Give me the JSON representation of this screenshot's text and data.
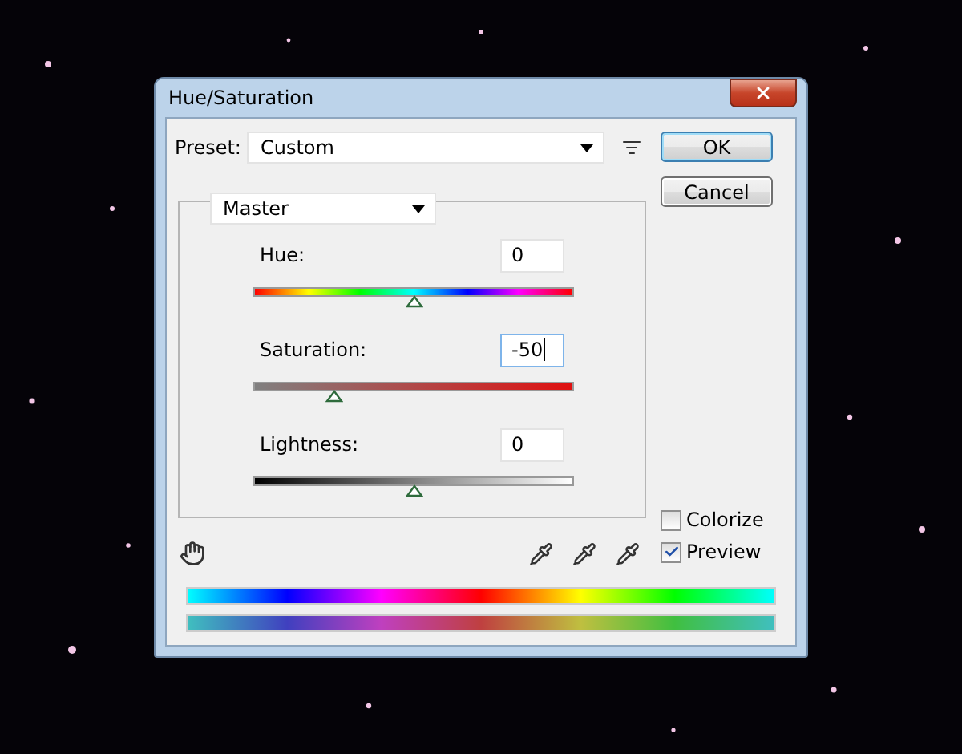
{
  "window": {
    "title": "Hue/Saturation"
  },
  "preset": {
    "label": "Preset:",
    "value": "Custom"
  },
  "buttons": [
    {
      "label": "OK",
      "default": true
    },
    {
      "label": "Cancel",
      "default": false
    }
  ],
  "channel": {
    "value": "Master"
  },
  "sliders": [
    {
      "kind": "hue",
      "label": "Hue:",
      "value": "0",
      "level": 0.5,
      "focused": false
    },
    {
      "kind": "saturation",
      "label": "Saturation:",
      "value": "-50",
      "level": 0.25,
      "focused": true
    },
    {
      "kind": "lightness",
      "label": "Lightness:",
      "value": "0",
      "level": 0.5,
      "focused": false
    }
  ],
  "options": [
    {
      "label": "Colorize",
      "checked": false
    },
    {
      "label": "Preview",
      "checked": true
    }
  ]
}
